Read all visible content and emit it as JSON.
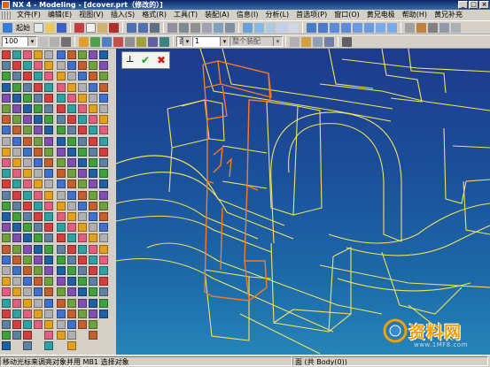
{
  "window": {
    "title": "NX 4 - Modeling - [dcover.prt（修改的）]",
    "controls": [
      "_",
      "□",
      "×"
    ]
  },
  "menu": {
    "items": [
      "文件(F)",
      "编辑(E)",
      "视图(V)",
      "插入(S)",
      "格式(R)",
      "工具(T)",
      "装配(A)",
      "信息(I)",
      "分析(L)",
      "首选项(P)",
      "窗口(O)",
      "黄兄电极",
      "帮助(H)",
      "黄兄补充"
    ]
  },
  "toolbar1": {
    "start_label": "起始"
  },
  "toolbar2": {
    "zoom_value": "100",
    "layer_value": "面",
    "filter_value": "1",
    "display_placeholder": "整个装配"
  },
  "mini_toolbar": {
    "icons": [
      "edit-section-icon",
      "ok-check-icon",
      "cancel-x-icon"
    ],
    "ok_symbol": "✔",
    "cancel_symbol": "✖",
    "edit_symbol": "⊥"
  },
  "status": {
    "message": "移动光标来调亮对象并用 MB1 选择对象",
    "selection": "面 (共 Body(0))"
  },
  "watermark": {
    "text": "资料网",
    "url": "www.1MF8.com"
  },
  "colors": {
    "wire_yellow": "#f2e45a",
    "wire_orange": "#ff7a1a",
    "viewport_top": "#1e3a8c",
    "viewport_bottom": "#2584b8",
    "title_bar": "#0a246a"
  }
}
